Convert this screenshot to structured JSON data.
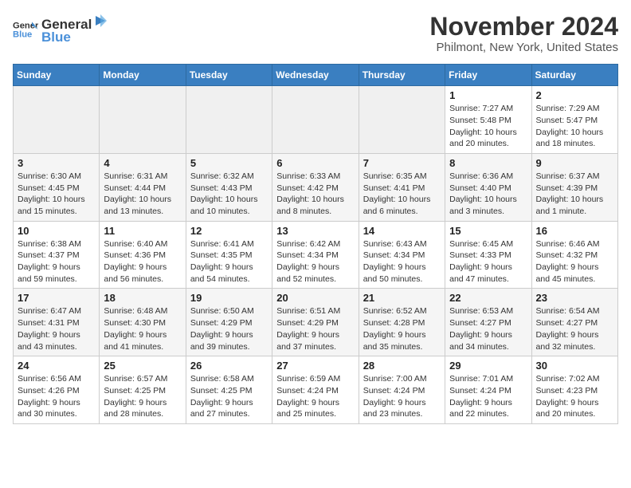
{
  "logo": {
    "general": "General",
    "blue": "Blue"
  },
  "title": "November 2024",
  "subtitle": "Philmont, New York, United States",
  "weekdays": [
    "Sunday",
    "Monday",
    "Tuesday",
    "Wednesday",
    "Thursday",
    "Friday",
    "Saturday"
  ],
  "weeks": [
    [
      {
        "day": "",
        "info": ""
      },
      {
        "day": "",
        "info": ""
      },
      {
        "day": "",
        "info": ""
      },
      {
        "day": "",
        "info": ""
      },
      {
        "day": "",
        "info": ""
      },
      {
        "day": "1",
        "info": "Sunrise: 7:27 AM\nSunset: 5:48 PM\nDaylight: 10 hours and 20 minutes."
      },
      {
        "day": "2",
        "info": "Sunrise: 7:29 AM\nSunset: 5:47 PM\nDaylight: 10 hours and 18 minutes."
      }
    ],
    [
      {
        "day": "3",
        "info": "Sunrise: 6:30 AM\nSunset: 4:45 PM\nDaylight: 10 hours and 15 minutes."
      },
      {
        "day": "4",
        "info": "Sunrise: 6:31 AM\nSunset: 4:44 PM\nDaylight: 10 hours and 13 minutes."
      },
      {
        "day": "5",
        "info": "Sunrise: 6:32 AM\nSunset: 4:43 PM\nDaylight: 10 hours and 10 minutes."
      },
      {
        "day": "6",
        "info": "Sunrise: 6:33 AM\nSunset: 4:42 PM\nDaylight: 10 hours and 8 minutes."
      },
      {
        "day": "7",
        "info": "Sunrise: 6:35 AM\nSunset: 4:41 PM\nDaylight: 10 hours and 6 minutes."
      },
      {
        "day": "8",
        "info": "Sunrise: 6:36 AM\nSunset: 4:40 PM\nDaylight: 10 hours and 3 minutes."
      },
      {
        "day": "9",
        "info": "Sunrise: 6:37 AM\nSunset: 4:39 PM\nDaylight: 10 hours and 1 minute."
      }
    ],
    [
      {
        "day": "10",
        "info": "Sunrise: 6:38 AM\nSunset: 4:37 PM\nDaylight: 9 hours and 59 minutes."
      },
      {
        "day": "11",
        "info": "Sunrise: 6:40 AM\nSunset: 4:36 PM\nDaylight: 9 hours and 56 minutes."
      },
      {
        "day": "12",
        "info": "Sunrise: 6:41 AM\nSunset: 4:35 PM\nDaylight: 9 hours and 54 minutes."
      },
      {
        "day": "13",
        "info": "Sunrise: 6:42 AM\nSunset: 4:34 PM\nDaylight: 9 hours and 52 minutes."
      },
      {
        "day": "14",
        "info": "Sunrise: 6:43 AM\nSunset: 4:34 PM\nDaylight: 9 hours and 50 minutes."
      },
      {
        "day": "15",
        "info": "Sunrise: 6:45 AM\nSunset: 4:33 PM\nDaylight: 9 hours and 47 minutes."
      },
      {
        "day": "16",
        "info": "Sunrise: 6:46 AM\nSunset: 4:32 PM\nDaylight: 9 hours and 45 minutes."
      }
    ],
    [
      {
        "day": "17",
        "info": "Sunrise: 6:47 AM\nSunset: 4:31 PM\nDaylight: 9 hours and 43 minutes."
      },
      {
        "day": "18",
        "info": "Sunrise: 6:48 AM\nSunset: 4:30 PM\nDaylight: 9 hours and 41 minutes."
      },
      {
        "day": "19",
        "info": "Sunrise: 6:50 AM\nSunset: 4:29 PM\nDaylight: 9 hours and 39 minutes."
      },
      {
        "day": "20",
        "info": "Sunrise: 6:51 AM\nSunset: 4:29 PM\nDaylight: 9 hours and 37 minutes."
      },
      {
        "day": "21",
        "info": "Sunrise: 6:52 AM\nSunset: 4:28 PM\nDaylight: 9 hours and 35 minutes."
      },
      {
        "day": "22",
        "info": "Sunrise: 6:53 AM\nSunset: 4:27 PM\nDaylight: 9 hours and 34 minutes."
      },
      {
        "day": "23",
        "info": "Sunrise: 6:54 AM\nSunset: 4:27 PM\nDaylight: 9 hours and 32 minutes."
      }
    ],
    [
      {
        "day": "24",
        "info": "Sunrise: 6:56 AM\nSunset: 4:26 PM\nDaylight: 9 hours and 30 minutes."
      },
      {
        "day": "25",
        "info": "Sunrise: 6:57 AM\nSunset: 4:25 PM\nDaylight: 9 hours and 28 minutes."
      },
      {
        "day": "26",
        "info": "Sunrise: 6:58 AM\nSunset: 4:25 PM\nDaylight: 9 hours and 27 minutes."
      },
      {
        "day": "27",
        "info": "Sunrise: 6:59 AM\nSunset: 4:24 PM\nDaylight: 9 hours and 25 minutes."
      },
      {
        "day": "28",
        "info": "Sunrise: 7:00 AM\nSunset: 4:24 PM\nDaylight: 9 hours and 23 minutes."
      },
      {
        "day": "29",
        "info": "Sunrise: 7:01 AM\nSunset: 4:24 PM\nDaylight: 9 hours and 22 minutes."
      },
      {
        "day": "30",
        "info": "Sunrise: 7:02 AM\nSunset: 4:23 PM\nDaylight: 9 hours and 20 minutes."
      }
    ]
  ]
}
